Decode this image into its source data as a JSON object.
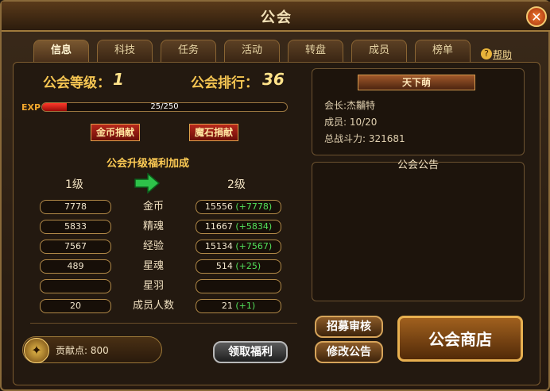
{
  "window": {
    "title": "公会",
    "close_label": "✕"
  },
  "tabs": [
    {
      "label": "信息",
      "active": true
    },
    {
      "label": "科技"
    },
    {
      "label": "任务"
    },
    {
      "label": "活动"
    },
    {
      "label": "转盘"
    },
    {
      "label": "成员"
    },
    {
      "label": "榜单"
    }
  ],
  "help": {
    "icon": "?",
    "label": "帮助"
  },
  "guild": {
    "level_label": "公会等级：",
    "level": "1",
    "rank_label": "公会排行：",
    "rank": "36",
    "exp_tag": "EXP",
    "exp_text": "25/250",
    "exp_fraction": 0.1
  },
  "donate": {
    "gold_label": "金币捐献",
    "diamond_label": "魔石捐献"
  },
  "upgrade": {
    "title": "公会升级福利加成",
    "col_current": "1级",
    "col_next": "2级",
    "rows": [
      {
        "label": "金币",
        "current": "7778",
        "next": "15556",
        "plus": "(+7778)"
      },
      {
        "label": "精魂",
        "current": "5833",
        "next": "11667",
        "plus": "(+5834)"
      },
      {
        "label": "经验",
        "current": "7567",
        "next": "15134",
        "plus": "(+7567)"
      },
      {
        "label": "星魂",
        "current": "489",
        "next": "514",
        "plus": "(+25)"
      },
      {
        "label": "星羽",
        "current": "",
        "next": "",
        "plus": ""
      },
      {
        "label": "成员人数",
        "current": "20",
        "next": "21",
        "plus": "(+1)"
      }
    ]
  },
  "info": {
    "name": "天下萌",
    "leader": "会长:杰黼特",
    "members": "成员: 10/20",
    "power_label": "总战斗力:",
    "power": "321681"
  },
  "notice": {
    "title": "公会公告"
  },
  "contribution": {
    "label": "贡献点: 800"
  },
  "buttons": {
    "claim": "领取福利",
    "recruit_review": "招募审核",
    "edit_notice": "修改公告",
    "shop": "公会商店"
  },
  "colors": {
    "accent": "#ffcf4a",
    "plus_green": "#52e05a",
    "exp_fill": "#ff3a2a"
  }
}
